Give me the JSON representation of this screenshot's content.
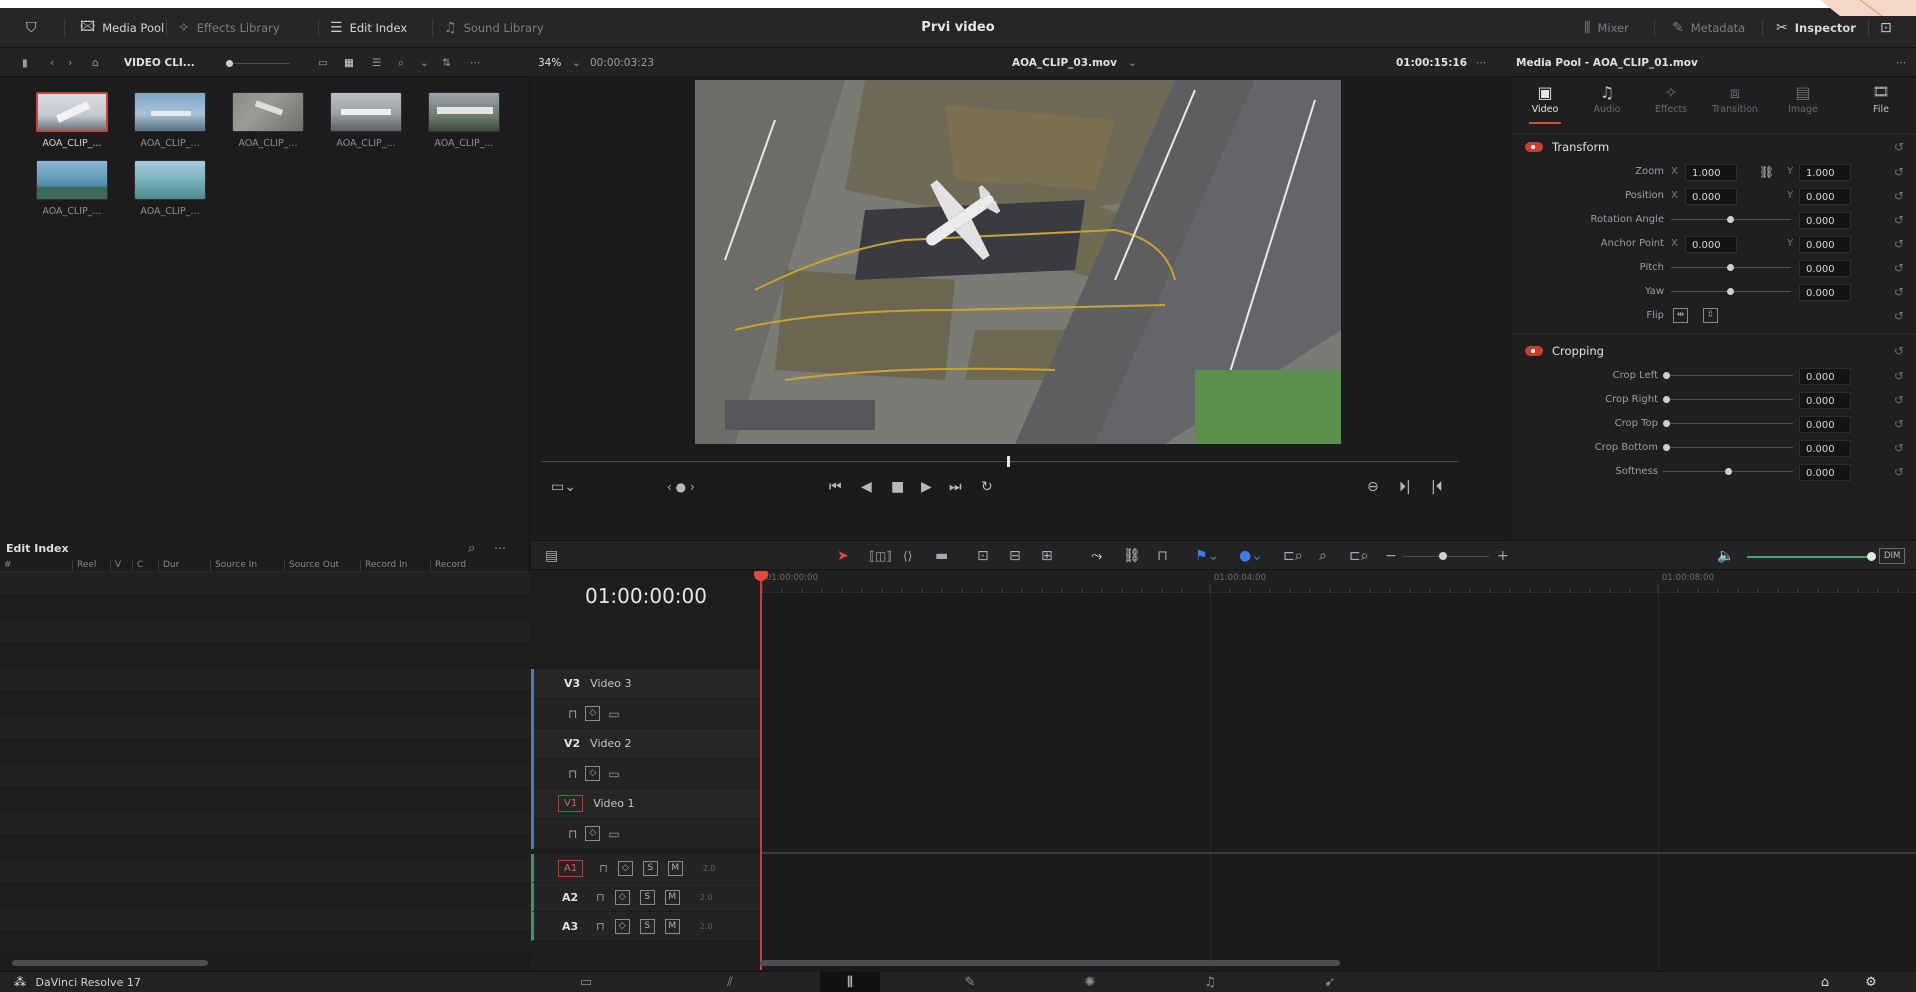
{
  "project_name": "Prvi video",
  "topbar": {
    "media_pool": "Media Pool",
    "effects_library": "Effects Library",
    "edit_index": "Edit Index",
    "sound_library": "Sound Library",
    "mixer": "Mixer",
    "metadata": "Metadata",
    "inspector": "Inspector"
  },
  "subbar": {
    "bin_name": "VIDEO CLI...",
    "zoom": "34%",
    "source_timecode": "00:00:03:23",
    "clip_name": "AOA_CLIP_03.mov",
    "record_timecode": "01:00:15:16",
    "inspector_title": "Media Pool - AOA_CLIP_01.mov"
  },
  "media_pool": {
    "clips": [
      {
        "label": "AOA_CLIP_..."
      },
      {
        "label": "AOA_CLIP_..."
      },
      {
        "label": "AOA_CLIP_..."
      },
      {
        "label": "AOA_CLIP_..."
      },
      {
        "label": "AOA_CLIP_..."
      },
      {
        "label": "AOA_CLIP_..."
      },
      {
        "label": "AOA_CLIP_..."
      }
    ]
  },
  "edit_index": {
    "title": "Edit Index",
    "columns": [
      "#",
      "Reel",
      "V",
      "C",
      "Dur",
      "Source In",
      "Source Out",
      "Record In",
      "Record"
    ]
  },
  "timeline": {
    "timecode": "01:00:00:00",
    "ruler_labels": [
      "01:00:00:00",
      "01:00:04:00",
      "01:00:08:00"
    ],
    "video_tracks": [
      {
        "id": "V3",
        "name": "Video 3"
      },
      {
        "id": "V2",
        "name": "Video 2"
      },
      {
        "id": "V1",
        "name": "Video 1"
      }
    ],
    "audio_tracks": [
      {
        "id": "A1",
        "level": "2.0"
      },
      {
        "id": "A2",
        "level": "2.0"
      },
      {
        "id": "A3",
        "level": "2.0"
      }
    ],
    "solo_label": "S",
    "mute_label": "M",
    "dim_label": "DIM"
  },
  "inspector": {
    "tabs": [
      {
        "label": "Video",
        "icon": "film-icon",
        "glyph": "▣"
      },
      {
        "label": "Audio",
        "icon": "music-icon",
        "glyph": "♫"
      },
      {
        "label": "Effects",
        "icon": "wand-icon",
        "glyph": "✧"
      },
      {
        "label": "Transition",
        "icon": "transition-icon",
        "glyph": "⧈"
      },
      {
        "label": "Image",
        "icon": "image-icon",
        "glyph": "▤"
      },
      {
        "label": "File",
        "icon": "file-icon",
        "glyph": "🎞"
      }
    ],
    "transform": {
      "title": "Transform",
      "zoom_label": "Zoom",
      "zoom_x": "1.000",
      "zoom_y": "1.000",
      "position_label": "Position",
      "position_x": "0.000",
      "position_y": "0.000",
      "rotation_label": "Rotation Angle",
      "rotation": "0.000",
      "anchor_label": "Anchor Point",
      "anchor_x": "0.000",
      "anchor_y": "0.000",
      "pitch_label": "Pitch",
      "pitch": "0.000",
      "yaw_label": "Yaw",
      "yaw": "0.000",
      "flip_label": "Flip",
      "x_axis": "X",
      "y_axis": "Y"
    },
    "cropping": {
      "title": "Cropping",
      "crop_left_label": "Crop Left",
      "crop_left": "0.000",
      "crop_right_label": "Crop Right",
      "crop_right": "0.000",
      "crop_top_label": "Crop Top",
      "crop_top": "0.000",
      "crop_bottom_label": "Crop Bottom",
      "crop_bottom": "0.000",
      "softness_label": "Softness",
      "softness": "0.000"
    }
  },
  "bottombar": {
    "app_name": "DaVinci Resolve 17"
  },
  "colors": {
    "accent_red": "#d03d2f",
    "video_track": "#4a7fb5",
    "audio_track": "#3e9a5a",
    "panel_bg": "#1e1e21"
  }
}
